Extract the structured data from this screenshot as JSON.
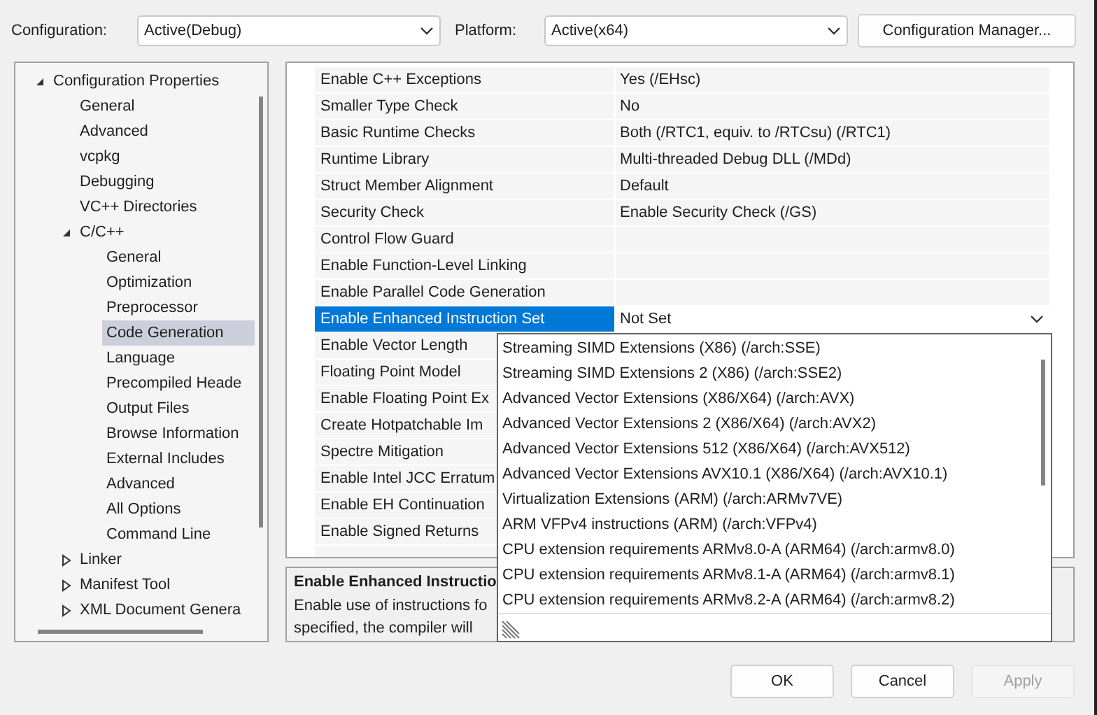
{
  "toolbar": {
    "configuration_label": "Configuration:",
    "configuration_value": "Active(Debug)",
    "platform_label": "Platform:",
    "platform_value": "Active(x64)",
    "manager_button": "Configuration Manager..."
  },
  "tree": [
    {
      "label": "Configuration Properties",
      "expanded": true,
      "selected": false,
      "children": [
        {
          "label": "General",
          "selected": false
        },
        {
          "label": "Advanced",
          "selected": false
        },
        {
          "label": "vcpkg",
          "selected": false
        },
        {
          "label": "Debugging",
          "selected": false
        },
        {
          "label": "VC++ Directories",
          "selected": false
        },
        {
          "label": "C/C++",
          "expanded": true,
          "selected": false,
          "children": [
            {
              "label": "General",
              "selected": false
            },
            {
              "label": "Optimization",
              "selected": false
            },
            {
              "label": "Preprocessor",
              "selected": false
            },
            {
              "label": "Code Generation",
              "selected": true
            },
            {
              "label": "Language",
              "selected": false
            },
            {
              "label": "Precompiled Heade",
              "selected": false
            },
            {
              "label": "Output Files",
              "selected": false
            },
            {
              "label": "Browse Information",
              "selected": false
            },
            {
              "label": "External Includes",
              "selected": false
            },
            {
              "label": "Advanced",
              "selected": false
            },
            {
              "label": "All Options",
              "selected": false
            },
            {
              "label": "Command Line",
              "selected": false
            }
          ]
        },
        {
          "label": "Linker",
          "expanded": false,
          "selected": false
        },
        {
          "label": "Manifest Tool",
          "expanded": false,
          "selected": false
        },
        {
          "label": "XML Document Genera",
          "expanded": false,
          "selected": false
        }
      ]
    }
  ],
  "properties": [
    {
      "name": "Enable C++ Exceptions",
      "value": "Yes (/EHsc)",
      "selected": false
    },
    {
      "name": "Smaller Type Check",
      "value": "No",
      "selected": false
    },
    {
      "name": "Basic Runtime Checks",
      "value": "Both (/RTC1, equiv. to /RTCsu) (/RTC1)",
      "selected": false
    },
    {
      "name": "Runtime Library",
      "value": "Multi-threaded Debug DLL (/MDd)",
      "selected": false
    },
    {
      "name": "Struct Member Alignment",
      "value": "Default",
      "selected": false
    },
    {
      "name": "Security Check",
      "value": "Enable Security Check (/GS)",
      "selected": false
    },
    {
      "name": "Control Flow Guard",
      "selected": false
    },
    {
      "name": "Enable Function-Level Linking",
      "selected": false
    },
    {
      "name": "Enable Parallel Code Generation",
      "selected": false
    },
    {
      "name": "Enable Enhanced Instruction Set",
      "value": "Not Set",
      "selected": true
    },
    {
      "name": "Enable Vector Length",
      "selected": false
    },
    {
      "name": "Floating Point Model",
      "selected": false
    },
    {
      "name": "Enable Floating Point Ex",
      "selected": false
    },
    {
      "name": "Create Hotpatchable Im",
      "selected": false
    },
    {
      "name": "Spectre Mitigation",
      "selected": false
    },
    {
      "name": "Enable Intel JCC Erratum",
      "selected": false
    },
    {
      "name": "Enable EH Continuation",
      "selected": false
    },
    {
      "name": "Enable Signed Returns",
      "selected": false
    }
  ],
  "dropdown_options": [
    "Streaming SIMD Extensions (X86) (/arch:SSE)",
    "Streaming SIMD Extensions 2 (X86) (/arch:SSE2)",
    "Advanced Vector Extensions (X86/X64) (/arch:AVX)",
    "Advanced Vector Extensions 2 (X86/X64) (/arch:AVX2)",
    "Advanced Vector Extensions 512 (X86/X64) (/arch:AVX512)",
    "Advanced Vector Extensions AVX10.1 (X86/X64) (/arch:AVX10.1)",
    "Virtualization Extensions (ARM) (/arch:ARMv7VE)",
    "ARM VFPv4 instructions (ARM) (/arch:VFPv4)",
    "CPU extension requirements ARMv8.0-A (ARM64) (/arch:armv8.0)",
    "CPU extension requirements ARMv8.1-A (ARM64) (/arch:armv8.1)",
    "CPU extension requirements ARMv8.2-A (ARM64) (/arch:armv8.2)"
  ],
  "description": {
    "title": "Enable Enhanced Instructio",
    "lines": [
      "Enable use of instructions fo",
      "specified, the compiler will"
    ]
  },
  "buttons": [
    {
      "label": "OK",
      "disabled": false
    },
    {
      "label": "Cancel",
      "disabled": false
    },
    {
      "label": "Apply",
      "disabled": true
    }
  ]
}
